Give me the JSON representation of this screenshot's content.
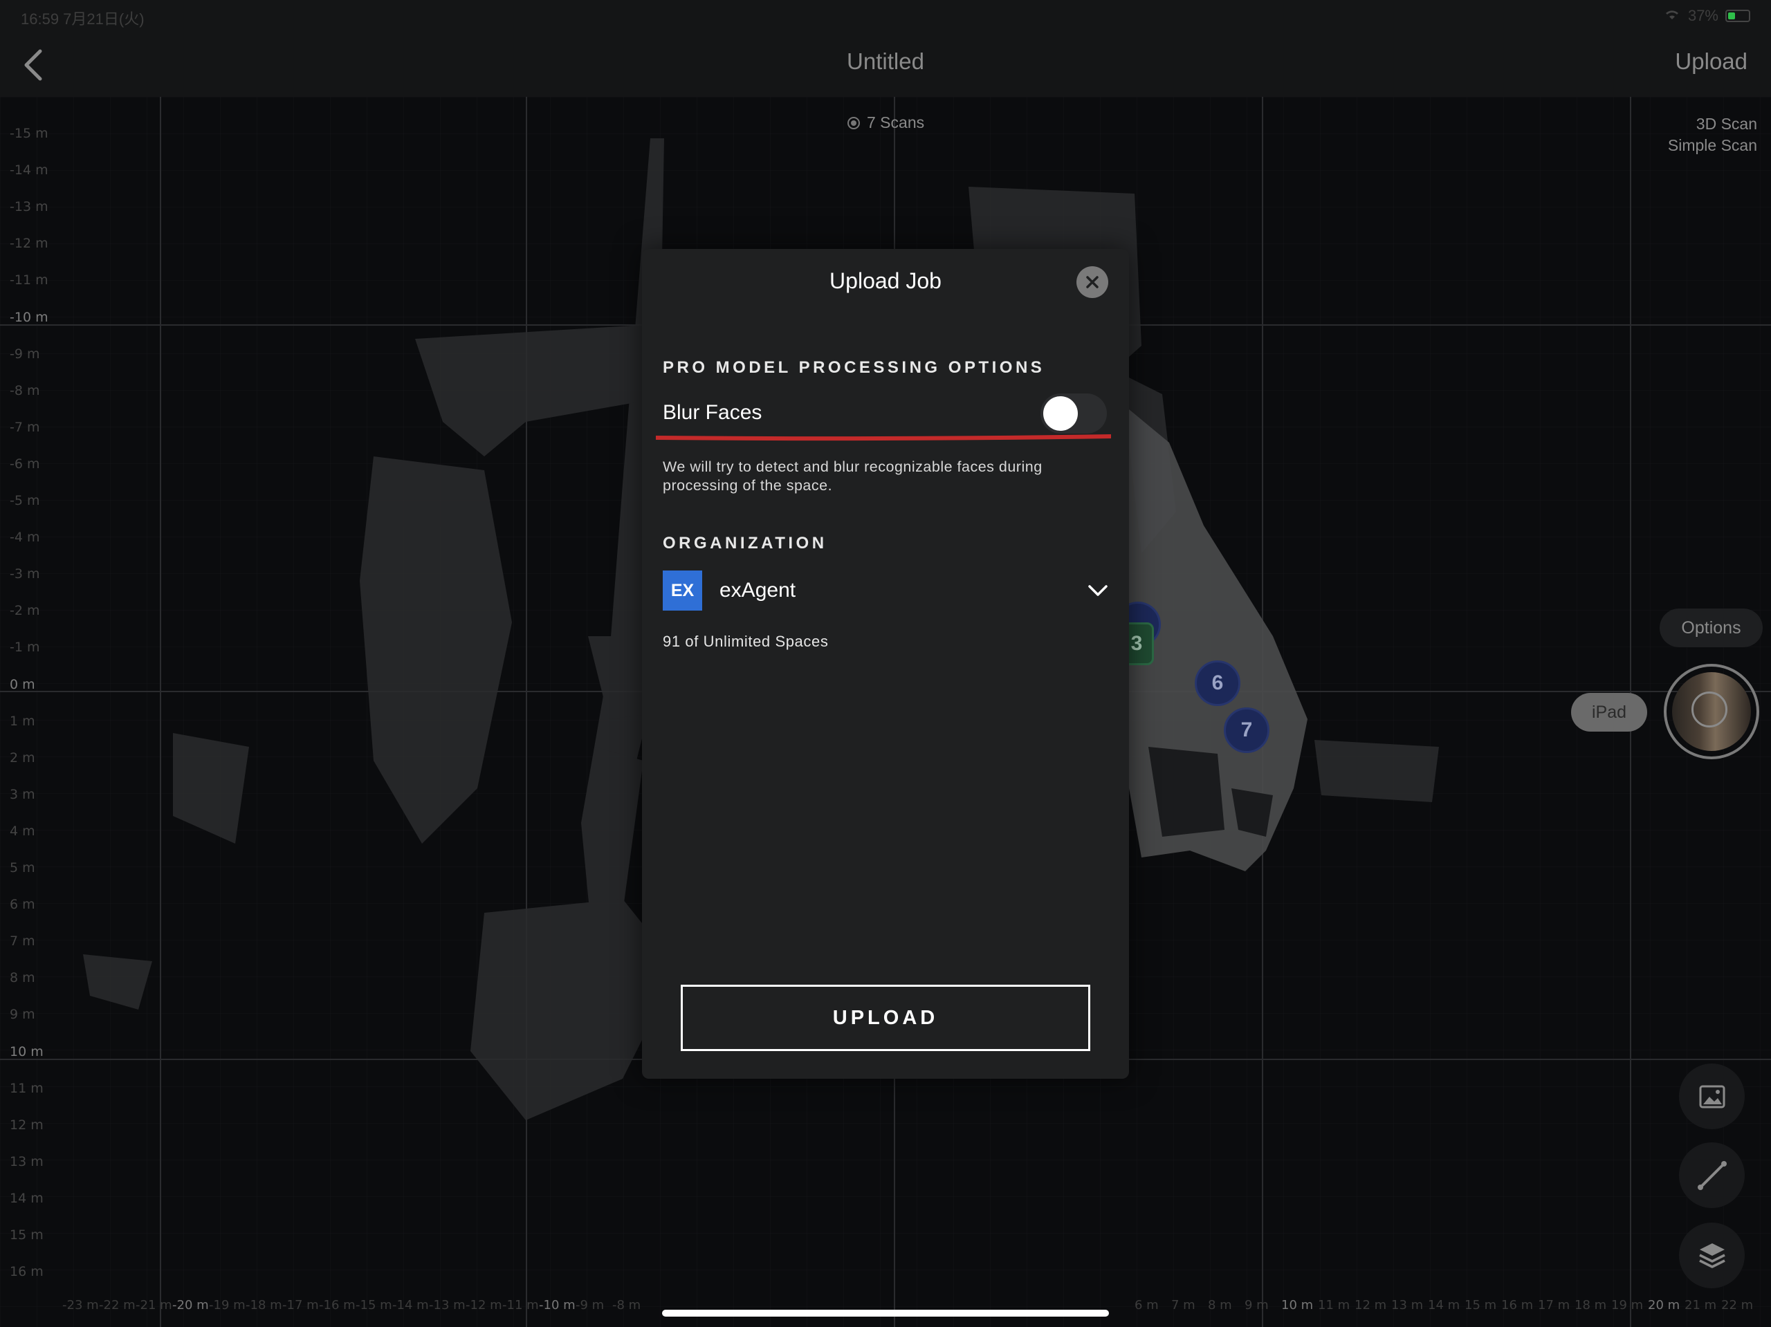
{
  "status_bar": {
    "time": "16:59  7月21日(火)",
    "battery": "37%"
  },
  "nav": {
    "title": "Untitled",
    "upload_label": "Upload"
  },
  "scans": {
    "count_label": "7 Scans"
  },
  "scan_types": [
    "3D Scan",
    "Simple Scan"
  ],
  "ruler": {
    "left": [
      {
        "label": "-15 m",
        "major": false
      },
      {
        "label": "-14 m",
        "major": false
      },
      {
        "label": "-13 m",
        "major": false
      },
      {
        "label": "-12 m",
        "major": false
      },
      {
        "label": "-11 m",
        "major": false
      },
      {
        "label": "-10 m",
        "major": true
      },
      {
        "label": "-9 m",
        "major": false
      },
      {
        "label": "-8 m",
        "major": false
      },
      {
        "label": "-7 m",
        "major": false
      },
      {
        "label": "-6 m",
        "major": false
      },
      {
        "label": "-5 m",
        "major": false
      },
      {
        "label": "-4 m",
        "major": false
      },
      {
        "label": "-3 m",
        "major": false
      },
      {
        "label": "-2 m",
        "major": false
      },
      {
        "label": "-1 m",
        "major": false
      },
      {
        "label": "0 m",
        "major": true
      },
      {
        "label": "1 m",
        "major": false
      },
      {
        "label": "2 m",
        "major": false
      },
      {
        "label": "3 m",
        "major": false
      },
      {
        "label": "4 m",
        "major": false
      },
      {
        "label": "5 m",
        "major": false
      },
      {
        "label": "6 m",
        "major": false
      },
      {
        "label": "7 m",
        "major": false
      },
      {
        "label": "8 m",
        "major": false
      },
      {
        "label": "9 m",
        "major": false
      },
      {
        "label": "10 m",
        "major": true
      },
      {
        "label": "11 m",
        "major": false
      },
      {
        "label": "12 m",
        "major": false
      },
      {
        "label": "13 m",
        "major": false
      },
      {
        "label": "14 m",
        "major": false
      },
      {
        "label": "15 m",
        "major": false
      },
      {
        "label": "16 m",
        "major": false
      }
    ],
    "bottom": [
      {
        "label": "-23 m",
        "major": false
      },
      {
        "label": "-22 m",
        "major": false
      },
      {
        "label": "-21 m",
        "major": false
      },
      {
        "label": "-20 m",
        "major": true
      },
      {
        "label": "-19 m",
        "major": false
      },
      {
        "label": "-18 m",
        "major": false
      },
      {
        "label": "-17 m",
        "major": false
      },
      {
        "label": "-16 m",
        "major": false
      },
      {
        "label": "-15 m",
        "major": false
      },
      {
        "label": "-14 m",
        "major": false
      },
      {
        "label": "-13 m",
        "major": false
      },
      {
        "label": "-12 m",
        "major": false
      },
      {
        "label": "-11 m",
        "major": false
      },
      {
        "label": "-10 m",
        "major": true
      },
      {
        "label": "-9 m",
        "major": false
      },
      {
        "label": "-8 m",
        "major": false
      },
      {
        "label": "6 m",
        "major": false
      },
      {
        "label": "7 m",
        "major": false
      },
      {
        "label": "8 m",
        "major": false
      },
      {
        "label": "9 m",
        "major": false
      },
      {
        "label": "10 m",
        "major": true
      },
      {
        "label": "11 m",
        "major": false
      },
      {
        "label": "12 m",
        "major": false
      },
      {
        "label": "13 m",
        "major": false
      },
      {
        "label": "14 m",
        "major": false
      },
      {
        "label": "15 m",
        "major": false
      },
      {
        "label": "16 m",
        "major": false
      },
      {
        "label": "17 m",
        "major": false
      },
      {
        "label": "18 m",
        "major": false
      },
      {
        "label": "19 m",
        "major": false
      },
      {
        "label": "20 m",
        "major": true
      },
      {
        "label": "21 m",
        "major": false
      },
      {
        "label": "22 m",
        "major": false
      }
    ]
  },
  "markers": {
    "m6": "6",
    "m7": "7",
    "m3": "3"
  },
  "controls": {
    "options_label": "Options",
    "device_label": "iPad"
  },
  "icons": {
    "back": "chevron-left-icon",
    "close": "close-icon",
    "chevron": "chevron-down-icon",
    "gallery": "image-icon",
    "measure": "ruler-line-icon",
    "layers": "layers-icon"
  },
  "modal": {
    "title": "Upload Job",
    "section_processing": "PRO MODEL PROCESSING OPTIONS",
    "blur_faces_label": "Blur Faces",
    "blur_faces_enabled": false,
    "blur_faces_description": "We will try to detect and blur recognizable faces during processing of the space.",
    "section_organization": "ORGANIZATION",
    "org_badge": "EX",
    "org_name": "exAgent",
    "org_spaces": "91 of Unlimited Spaces",
    "upload_button": "UPLOAD"
  },
  "colors": {
    "modal_bg": "#1f2021",
    "org_badge": "#2f6fd6",
    "annotation_underline": "#c42a2a",
    "marker_blue": "#1c2858",
    "marker_green": "#1f4a31"
  }
}
